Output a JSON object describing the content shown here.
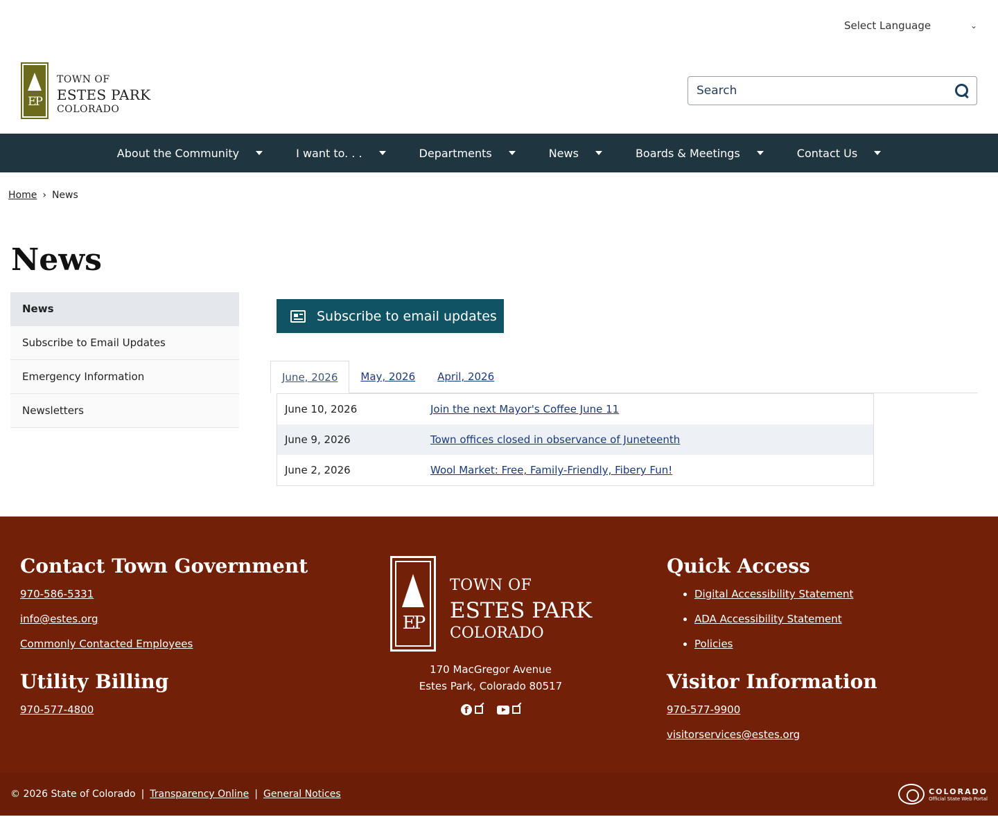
{
  "top": {
    "language_select": "Select Language"
  },
  "header": {
    "logo": {
      "line1": "TOWN OF",
      "line2": "ESTES PARK",
      "line3": "COLORADO",
      "mark": "EP"
    },
    "search": {
      "placeholder": "Search"
    }
  },
  "nav": {
    "items": [
      {
        "label": "About the Community"
      },
      {
        "label": "I want to. . ."
      },
      {
        "label": "Departments"
      },
      {
        "label": "News"
      },
      {
        "label": "Boards & Meetings"
      },
      {
        "label": "Contact Us"
      }
    ]
  },
  "breadcrumb": {
    "home": "Home",
    "separator": "›",
    "current": "News"
  },
  "page": {
    "title": "News"
  },
  "sidebar": {
    "items": [
      {
        "label": "News"
      },
      {
        "label": "Subscribe to Email Updates"
      },
      {
        "label": "Emergency Information"
      },
      {
        "label": "Newsletters"
      }
    ]
  },
  "main": {
    "subscribe_label": "Subscribe to email updates",
    "tabs": [
      {
        "label": "June, 2026"
      },
      {
        "label": "May, 2026"
      },
      {
        "label": "April, 2026"
      }
    ],
    "rows": [
      {
        "date": "June 10, 2026",
        "title": "Join the next Mayor's Coffee June 11"
      },
      {
        "date": "June 9, 2026",
        "title": "Town offices closed in observance of Juneteenth"
      },
      {
        "date": "June 2, 2026",
        "title": "Wool Market: Free, Family-Friendly, Fibery Fun!"
      }
    ]
  },
  "footer": {
    "contact": {
      "heading": "Contact Town Government",
      "phone": "970-586-5331",
      "email": "info@estes.org",
      "employees": "Commonly Contacted Employees"
    },
    "utility": {
      "heading": "Utility Billing",
      "phone": "970-577-4800"
    },
    "center": {
      "logo": {
        "line1": "TOWN OF",
        "line2": "ESTES PARK",
        "line3": "COLORADO",
        "mark": "EP"
      },
      "address1": "170 MacGregor Avenue",
      "address2": "Estes Park, Colorado 80517"
    },
    "quick": {
      "heading": "Quick Access",
      "links": [
        {
          "label": "Digital Accessibility Statement"
        },
        {
          "label": "ADA Accessibility Statement"
        },
        {
          "label": "Policies"
        }
      ]
    },
    "visitor": {
      "heading": "Visitor Information",
      "phone": "970-577-9900",
      "email": "visitorservices@estes.org"
    },
    "bottom": {
      "copyright": "© 2026 State of Colorado",
      "sep": "|",
      "transparency": "Transparency Online",
      "notices": "General Notices",
      "colorado_title": "COLORADO",
      "colorado_sub": "Official State Web Portal"
    }
  },
  "colors": {
    "nav_bg": "#1f3540",
    "button": "#0f5365",
    "footer_bg": "#722008",
    "logo_green": "#6b6a1d"
  }
}
